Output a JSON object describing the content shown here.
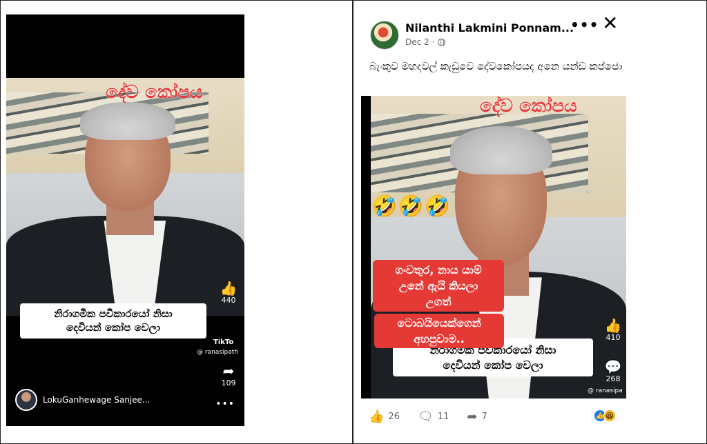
{
  "left_video": {
    "overlay_title": "දේව කෝපය",
    "caption_lines": [
      "නිරාගමික පවිකාරයෝ නිසා",
      "දෙවියන් කෝප වෙලා"
    ],
    "like_count": "440",
    "share_count": "109",
    "tiktok_label": "TikTo",
    "tiktok_handle": "@ ranasipath",
    "author_name": "LokuGanhewage Sanjee..."
  },
  "post": {
    "author": "Nilanthi Lakmini Ponnam...",
    "date": "Dec 2",
    "text": "බැංකුව මහදවල් කැඩුවෙ දේවකෝපයද අනෙ යන්ඩ කප්ජො",
    "video": {
      "overlay_title": "දේව කෝපය",
      "emoji": "🤣🤣🤣",
      "red_caption_lines": [
        "ගංවතුර, නාය යාම්",
        "උනේ ඇයි කියලා",
        "උගත්",
        "ටොබයියෙක්ගෙන්",
        "අහපුවාම.."
      ],
      "caption_lines": [
        "නිරාගමික පවිකාරයෝ නිසා",
        "දෙවියන් කෝප වෙලා"
      ],
      "like_count": "410",
      "comment_count": "268",
      "tiktok_handle": "@ ranasipa"
    },
    "reactions": {
      "likes": "26",
      "comments": "11",
      "shares": "7"
    }
  },
  "icons": {
    "like": "like-icon",
    "comment": "comment-icon",
    "share": "share-icon",
    "more": "more-icon",
    "close": "close-icon",
    "globe": "globe-icon"
  }
}
